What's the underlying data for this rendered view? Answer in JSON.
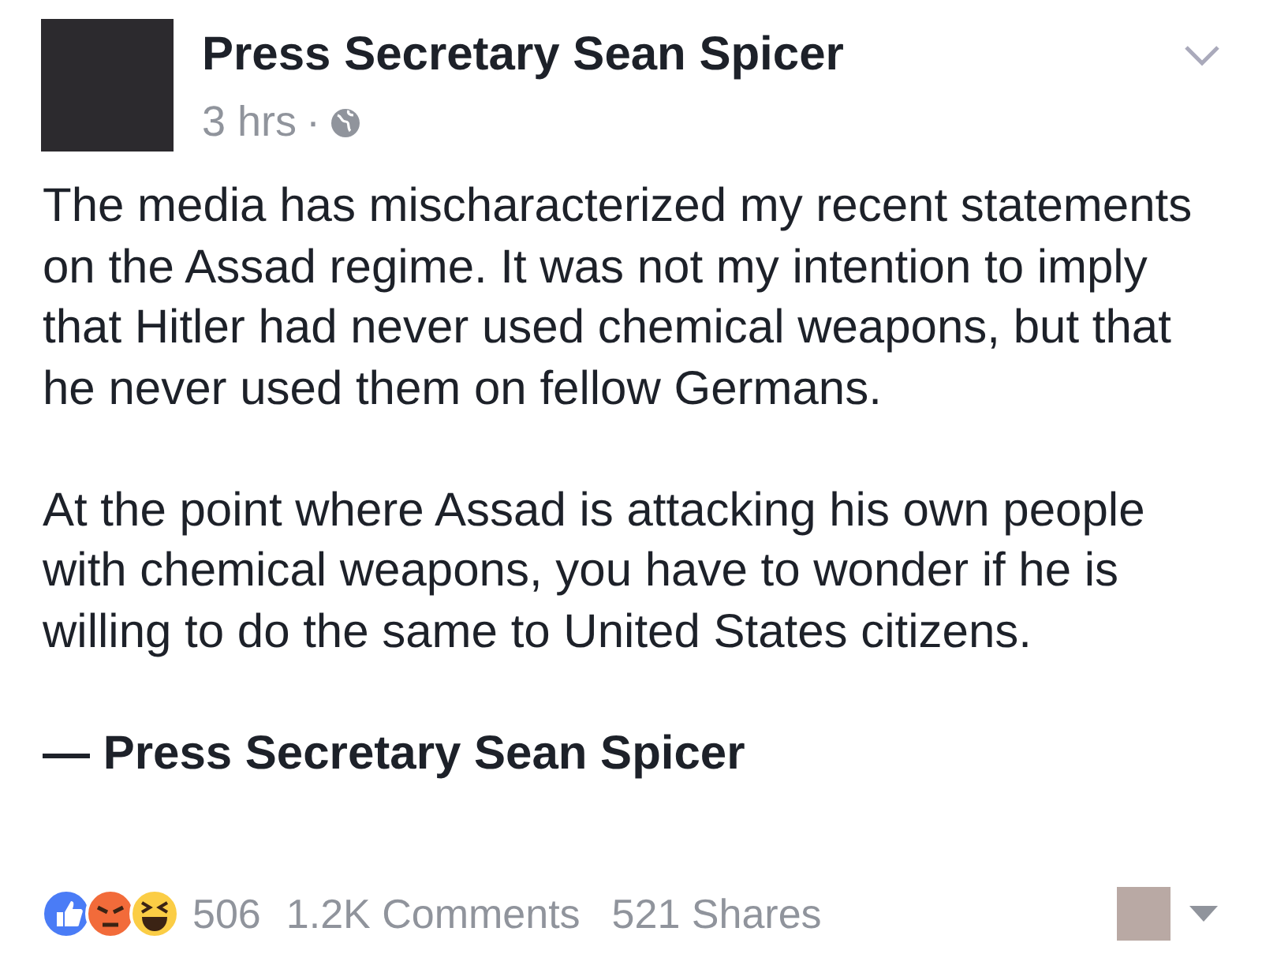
{
  "post": {
    "author": "Press Secretary Sean Spicer",
    "time": "3 hrs",
    "separator": "·",
    "paragraphs": [
      "The media has mischaracterized my recent statements on the Assad regime. It was not my intention to imply that Hitler had never used chemical weapons, but that he never used them on fellow Germans.",
      "At the point where Assad is attacking his own people with chemical weapons, you have to wonder if he is willing to do the same to United States citizens."
    ],
    "signature": "— Press Secretary Sean Spicer"
  },
  "reactions": {
    "count": "506",
    "comments": "1.2K Comments",
    "shares": "521 Shares",
    "types": [
      {
        "kind": "like"
      },
      {
        "kind": "angry"
      },
      {
        "kind": "haha"
      }
    ]
  }
}
